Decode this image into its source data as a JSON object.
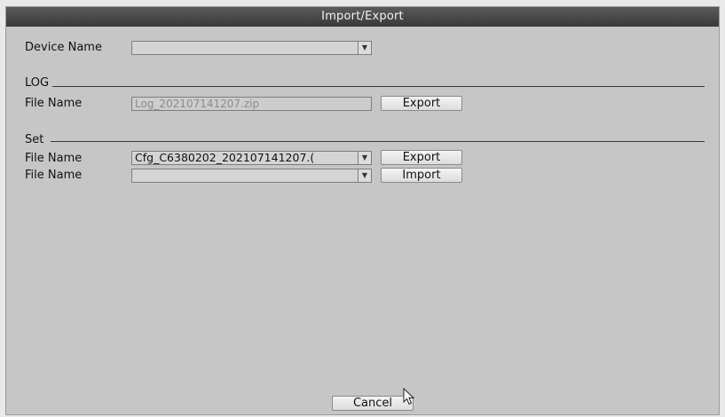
{
  "dialog": {
    "title": "Import/Export"
  },
  "device": {
    "label": "Device Name",
    "value": ""
  },
  "log_section": {
    "heading": "LOG",
    "file_label": "File Name",
    "file_value": "Log_202107141207.zip",
    "export_label": "Export"
  },
  "set_section": {
    "heading": "Set",
    "export_row": {
      "file_label": "File Name",
      "file_value": "Cfg_C6380202_202107141207.(",
      "button_label": "Export"
    },
    "import_row": {
      "file_label": "File Name",
      "file_value": "",
      "button_label": "Import"
    }
  },
  "footer": {
    "cancel_label": "Cancel"
  },
  "icons": {
    "dropdown": "chevron-down-icon",
    "pointer": "mouse-pointer-icon"
  }
}
